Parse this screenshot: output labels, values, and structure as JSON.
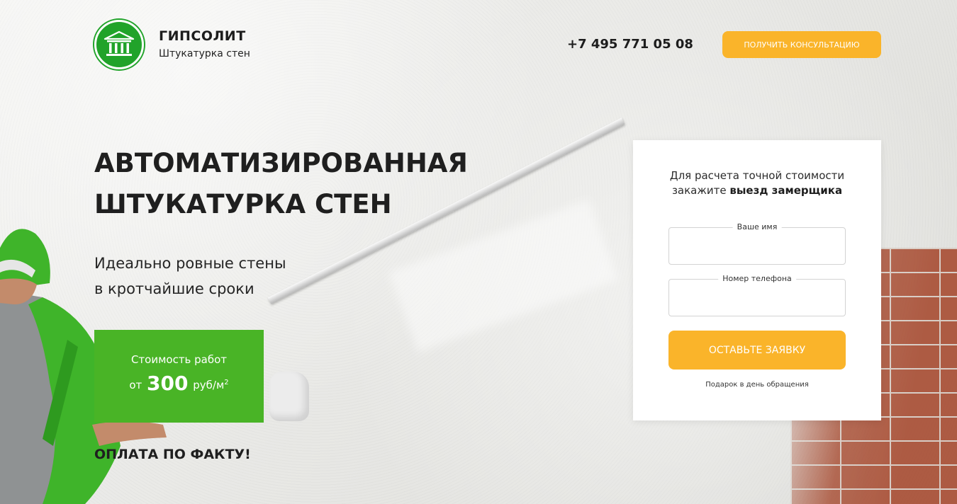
{
  "header": {
    "brand_name": "ГИПСОЛИТ",
    "brand_sub": "Штукатурка стен",
    "phone": "+7 495 771 05 08",
    "consult_button": "ПОЛУЧИТЬ КОНСУЛЬТАЦИЮ"
  },
  "hero": {
    "title_line1": "АВТОМАТИЗИРОВАННАЯ",
    "title_line2": "ШТУКАТУРКА СТЕН",
    "sub_line1": "Идеально ровные стены",
    "sub_line2": "в кротчайшие сроки",
    "price_label": "Стоимость работ",
    "price_from": "от",
    "price_value": "300",
    "price_unit": "руб/м",
    "price_unit_sup": "2",
    "payment_note": "ОПЛАТА ПО ФАКТУ!"
  },
  "form": {
    "title_line1": "Для расчета точной стоимости",
    "title_line2_prefix": "закажите",
    "title_line2_bold": "выезд замерщика",
    "name_label": "Ваше имя",
    "name_value": "",
    "phone_label": "Номер телефона",
    "phone_value": "",
    "submit_button": "ОСТАВЬТЕ ЗАЯВКУ",
    "gift_note": "Подарок в день обращения"
  },
  "colors": {
    "accent_orange": "#fab42a",
    "brand_green": "#49b426",
    "logo_green": "#21a32a"
  },
  "icons": {
    "logo": "building-columns-icon"
  }
}
